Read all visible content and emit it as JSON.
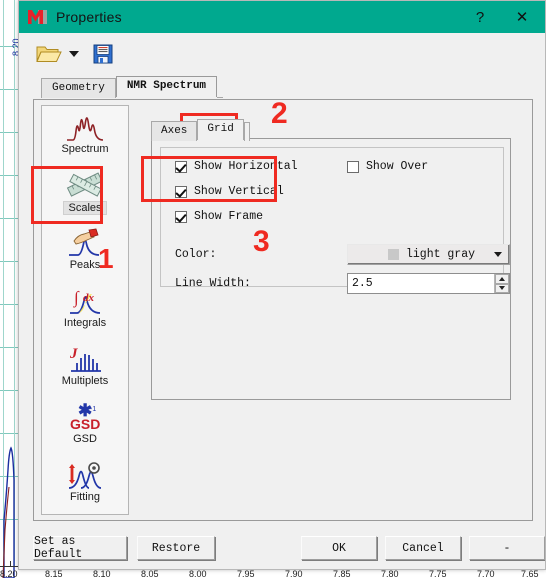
{
  "window": {
    "title": "Properties",
    "logo_icon": "mnova-m-logo-icon",
    "help_label": "?",
    "close_label": "✕",
    "titlebar_color": "#00a98f"
  },
  "toolbar": {
    "open_icon": "open-folder-icon",
    "dropdown_icon": "chevron-down-icon",
    "save_icon": "floppy-disk-save-icon"
  },
  "main_tabs": [
    {
      "label": "Geometry",
      "active": false
    },
    {
      "label": "NMR Spectrum",
      "active": true
    }
  ],
  "sidebar": {
    "items": [
      {
        "label": "Spectrum",
        "icon": "spectrum-peaks-icon",
        "selected": false
      },
      {
        "label": "Scales",
        "icon": "crossed-rulers-icon",
        "selected": true
      },
      {
        "label": "Peaks",
        "icon": "hand-pen-peak-icon",
        "selected": false
      },
      {
        "label": "Integrals",
        "icon": "integral-dx-icon",
        "selected": false
      },
      {
        "label": "Multiplets",
        "icon": "j-coupling-comb-icon",
        "selected": false
      },
      {
        "label": "GSD",
        "icon": "gsd-asterisk-icon",
        "selected": false
      },
      {
        "label": "Fitting",
        "icon": "fitting-gear-icon",
        "selected": false
      }
    ]
  },
  "sub_tabs": [
    {
      "label": "Axes",
      "active": false
    },
    {
      "label": "Grid",
      "active": true
    }
  ],
  "grid_panel": {
    "checkboxes": [
      {
        "label": "Show Horizontal",
        "checked": true
      },
      {
        "label": "Show Vertical",
        "checked": true
      },
      {
        "label": "Show Frame",
        "checked": true
      },
      {
        "label": "Show Over",
        "checked": false
      }
    ],
    "color_field": {
      "label": "Color:",
      "value": "light gray",
      "swatch_hex": "#c8c8c8",
      "dropdown_icon": "chevron-down-icon"
    },
    "line_width_field": {
      "label": "Line Width:",
      "value": "2.5",
      "spinner_up_icon": "spinner-up-icon",
      "spinner_down_icon": "spinner-down-icon"
    }
  },
  "buttons": {
    "set_as_default": "Set as Default",
    "restore": "Restore",
    "ok": "OK",
    "cancel": "Cancel",
    "extra": "-"
  },
  "annotations": [
    {
      "number": "1",
      "target": "sidebar-item-scales"
    },
    {
      "number": "2",
      "target": "sub-tab-grid"
    },
    {
      "number": "3",
      "target": "color-and-linewidth-fields"
    }
  ],
  "background": {
    "axis_labels": [
      "8.20",
      "8.15",
      "8.10",
      "8.05",
      "8.00",
      "7.95",
      "7.90",
      "7.85",
      "7.80",
      "7.75",
      "7.70",
      "7.65"
    ],
    "y_label": "8.20",
    "grid_color": "#7fc9bd",
    "curve_color": "#1b2ea0"
  }
}
